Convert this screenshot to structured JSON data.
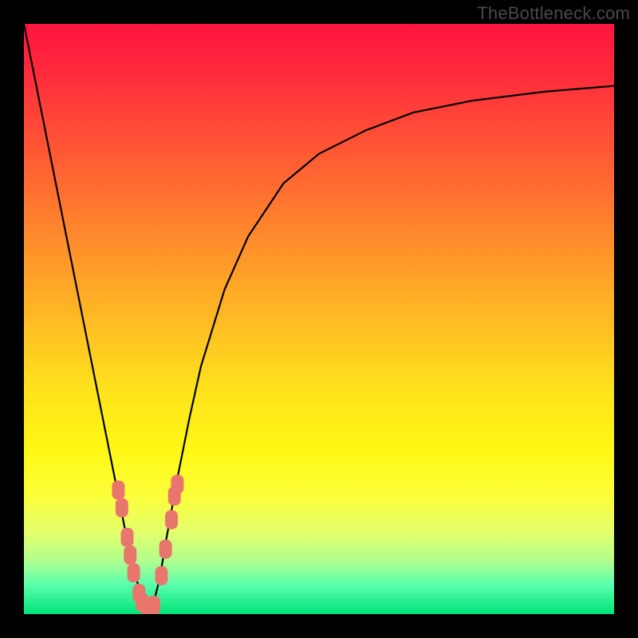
{
  "attribution": "TheBottleneck.com",
  "chart_data": {
    "type": "line",
    "title": "",
    "xlabel": "",
    "ylabel": "",
    "xlim": [
      0,
      100
    ],
    "ylim": [
      0,
      100
    ],
    "grid": false,
    "background_gradient": [
      "#ff153f",
      "#ff8a2c",
      "#fff714",
      "#00e57a"
    ],
    "series": [
      {
        "name": "bottleneck-curve",
        "color": "#000000",
        "x": [
          0,
          2,
          4,
          6,
          8,
          10,
          12,
          14,
          16,
          18,
          19,
          20,
          21,
          22,
          23,
          24,
          26,
          28,
          30,
          34,
          38,
          44,
          50,
          58,
          66,
          76,
          88,
          100
        ],
        "y": [
          100,
          90,
          80,
          70,
          60,
          50,
          40,
          30,
          20,
          10,
          6,
          3,
          0,
          2,
          6,
          12,
          23,
          33,
          42,
          55,
          64,
          73,
          78,
          82,
          85,
          87,
          88.5,
          89.5
        ]
      }
    ],
    "markers": [
      {
        "name": "data-points-cluster",
        "color": "#e9766d",
        "shape": "rounded-rect",
        "points": [
          {
            "x": 16.0,
            "y": 21.0
          },
          {
            "x": 16.6,
            "y": 18.0
          },
          {
            "x": 17.5,
            "y": 13.0
          },
          {
            "x": 18.0,
            "y": 10.0
          },
          {
            "x": 18.6,
            "y": 7.0
          },
          {
            "x": 19.5,
            "y": 3.5
          },
          {
            "x": 20.0,
            "y": 2.0
          },
          {
            "x": 21.0,
            "y": 0.5
          },
          {
            "x": 22.0,
            "y": 1.5
          },
          {
            "x": 23.3,
            "y": 6.5
          },
          {
            "x": 24.0,
            "y": 11.0
          },
          {
            "x": 25.0,
            "y": 16.0
          },
          {
            "x": 25.5,
            "y": 20.0
          },
          {
            "x": 26.0,
            "y": 22.0
          }
        ]
      }
    ]
  }
}
